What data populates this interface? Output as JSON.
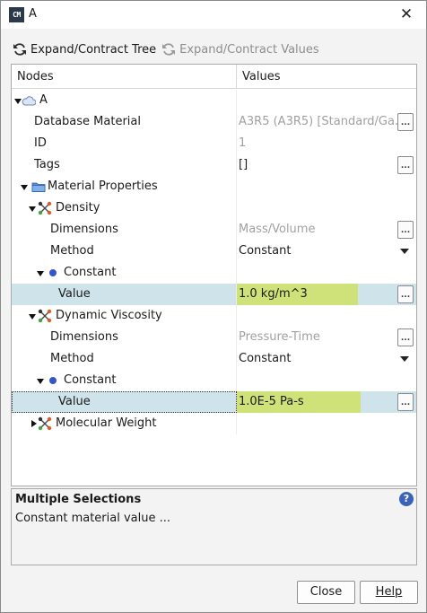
{
  "window": {
    "title": "A",
    "app_icon_text": "CM"
  },
  "toolbar": {
    "expand_tree": "Expand/Contract Tree",
    "expand_values": "Expand/Contract Values"
  },
  "tree": {
    "header_nodes": "Nodes",
    "header_values": "Values",
    "rows": [
      {
        "label": "A",
        "value": ""
      },
      {
        "label": "Database Material",
        "value": "A3R5 (A3R5) [Standard/Ga..."
      },
      {
        "label": "ID",
        "value": "1"
      },
      {
        "label": "Tags",
        "value": "[]"
      },
      {
        "label": "Material Properties",
        "value": ""
      },
      {
        "label": "Density",
        "value": ""
      },
      {
        "label": "Dimensions",
        "value": "Mass/Volume"
      },
      {
        "label": "Method",
        "value": "Constant"
      },
      {
        "label": "Constant",
        "value": ""
      },
      {
        "label": "Value",
        "value": "1.0 kg/m^3"
      },
      {
        "label": "Dynamic Viscosity",
        "value": ""
      },
      {
        "label": "Dimensions",
        "value": "Pressure-Time"
      },
      {
        "label": "Method",
        "value": "Constant"
      },
      {
        "label": "Constant",
        "value": ""
      },
      {
        "label": "Value",
        "value": "1.0E-5 Pa-s"
      },
      {
        "label": "Molecular Weight",
        "value": ""
      }
    ]
  },
  "description": {
    "title": "Multiple Selections",
    "text": "Constant material value ..."
  },
  "buttons": {
    "close": "Close",
    "help": "Help",
    "ellipsis": "..."
  },
  "colors": {
    "selection": "#cfe3ea",
    "value_highlight": "#cfe27a",
    "accent": "#3a64b8"
  }
}
